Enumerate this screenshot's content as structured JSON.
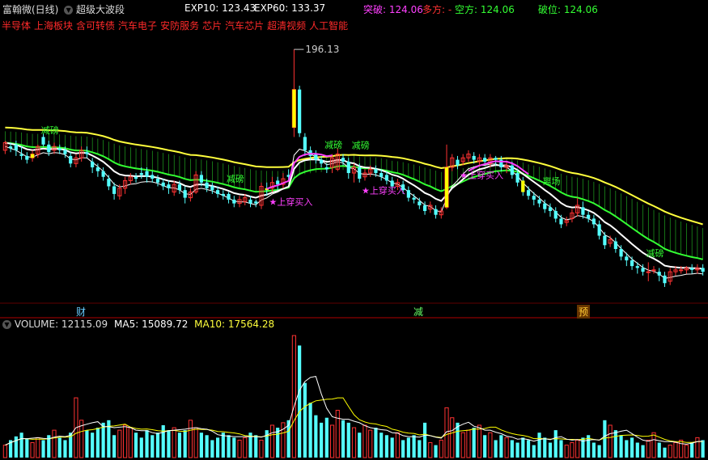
{
  "header": {
    "stock_name": "富翰微(日线)",
    "formula_name": "超级大波段",
    "exp10_label": "EXP10: 123.43",
    "exp60_label": "EXP60: 133.37",
    "tupo_label": "突破: 124.06",
    "duofang_label": "多方: -",
    "kongfang_label": "空方: 124.06",
    "powei_label": "破位: 124.06"
  },
  "sectors": [
    "半导体",
    "上海板块",
    "含可转债",
    "汽车电子",
    "安防服务",
    "芯片",
    "汽车芯片",
    "超清视频",
    "人工智能"
  ],
  "annotations": {
    "high_price": "196.13",
    "signal_reduce": "减磅",
    "signal_buy": "上穿买入",
    "signal_exit": "离场"
  },
  "bottom_markers": [
    "财",
    "减",
    "预"
  ],
  "volume_header": {
    "volume_label": "VOLUME: 12115.09",
    "ma5_label": "MA5: 15089.72",
    "ma10_label": "MA10: 17564.28"
  },
  "colors": {
    "up": "#ff3232",
    "down": "#54ffff",
    "exp10": "#ffffff",
    "exp60_yellow": "#ffff3c",
    "band_green": "#33ff33",
    "magenta": "#ff40ff",
    "vol_ma5": "#ffffff",
    "vol_ma10": "#ffff00"
  },
  "chart_data": {
    "type": "candlestick",
    "candles": [
      [
        143,
        147,
        148,
        141
      ],
      [
        145,
        144,
        147,
        142
      ],
      [
        146,
        143,
        148,
        140
      ],
      [
        141,
        140,
        145,
        138
      ],
      [
        140,
        138,
        142,
        136
      ],
      [
        139,
        141,
        143,
        137
      ],
      [
        141,
        145,
        146,
        139
      ],
      [
        150,
        146,
        152,
        145
      ],
      [
        146,
        142,
        148,
        140
      ],
      [
        143,
        145,
        147,
        141
      ],
      [
        144,
        143,
        146,
        141
      ],
      [
        143,
        141,
        145,
        139
      ],
      [
        140,
        136,
        142,
        134
      ],
      [
        136,
        139,
        141,
        134
      ],
      [
        139,
        143,
        145,
        137
      ],
      [
        142,
        141,
        145,
        139
      ],
      [
        137,
        134,
        139,
        131
      ],
      [
        134,
        132,
        136,
        129
      ],
      [
        132,
        129,
        134,
        127
      ],
      [
        128,
        124,
        130,
        122
      ],
      [
        124,
        120,
        126,
        117
      ],
      [
        119,
        123,
        125,
        117
      ],
      [
        123,
        127,
        129,
        120
      ],
      [
        127,
        129,
        131,
        125
      ],
      [
        129,
        128,
        131,
        126
      ],
      [
        131,
        130,
        134,
        128
      ],
      [
        132,
        129,
        134,
        126
      ],
      [
        130,
        128,
        132,
        126
      ],
      [
        128,
        126,
        130,
        124
      ],
      [
        126,
        124,
        128,
        122
      ],
      [
        125,
        123,
        127,
        120
      ],
      [
        121,
        125,
        127,
        119
      ],
      [
        125,
        122,
        127,
        120
      ],
      [
        122,
        118,
        124,
        115
      ],
      [
        118,
        121,
        123,
        116
      ],
      [
        121,
        130,
        132,
        120
      ],
      [
        130,
        126,
        132,
        124
      ],
      [
        126,
        123,
        128,
        121
      ],
      [
        124,
        122,
        126,
        120
      ],
      [
        122,
        120,
        124,
        118
      ],
      [
        120,
        119,
        122,
        117
      ],
      [
        120,
        117,
        121,
        115
      ],
      [
        117,
        115,
        119,
        113
      ],
      [
        115,
        117,
        119,
        113
      ],
      [
        116,
        118,
        120,
        114
      ],
      [
        117,
        115,
        119,
        113
      ],
      [
        116,
        115,
        117,
        113
      ],
      [
        114,
        124,
        126,
        112
      ],
      [
        123,
        122,
        126,
        119
      ],
      [
        123,
        126,
        129,
        121
      ],
      [
        127,
        125,
        129,
        122
      ],
      [
        125,
        128,
        131,
        123
      ],
      [
        130,
        129,
        133,
        127
      ],
      [
        155,
        175,
        196.13,
        150
      ],
      [
        175,
        152,
        177,
        150
      ],
      [
        150,
        143,
        152,
        140
      ],
      [
        143,
        140,
        145,
        138
      ],
      [
        141,
        138,
        143,
        136
      ],
      [
        138,
        136,
        140,
        134
      ],
      [
        134,
        133,
        136,
        131
      ],
      [
        134,
        139,
        141,
        131
      ],
      [
        133,
        141,
        144,
        132
      ],
      [
        139,
        137,
        141,
        135
      ],
      [
        137,
        131,
        139,
        128
      ],
      [
        131,
        134,
        136,
        126
      ],
      [
        134,
        128,
        136,
        126
      ],
      [
        129,
        131,
        133,
        127
      ],
      [
        131,
        133,
        135,
        129
      ],
      [
        133,
        131,
        135,
        129
      ],
      [
        131,
        129,
        133,
        127
      ],
      [
        130,
        127,
        132,
        125
      ],
      [
        127,
        124,
        129,
        122
      ],
      [
        124,
        126,
        128,
        122
      ],
      [
        125,
        122,
        127,
        120
      ],
      [
        122,
        118,
        124,
        116
      ],
      [
        118,
        117,
        120,
        115
      ],
      [
        116,
        114,
        118,
        112
      ],
      [
        114,
        111,
        116,
        109
      ],
      [
        112,
        114,
        116,
        110
      ],
      [
        112,
        109,
        114,
        107
      ],
      [
        109,
        111,
        113,
        107
      ],
      [
        113,
        134,
        146,
        112
      ],
      [
        134,
        139,
        141,
        132
      ],
      [
        138,
        135,
        140,
        133
      ],
      [
        137,
        139,
        141,
        135
      ],
      [
        139,
        141,
        143,
        137
      ],
      [
        140,
        138,
        142,
        136
      ],
      [
        137,
        139,
        141,
        135
      ],
      [
        139,
        137,
        141,
        135
      ],
      [
        136,
        139,
        141,
        134
      ],
      [
        139,
        138,
        140,
        135
      ],
      [
        138,
        134,
        140,
        132
      ],
      [
        134,
        135,
        137,
        131
      ],
      [
        135,
        130,
        137,
        128
      ],
      [
        131,
        126,
        133,
        124
      ],
      [
        127,
        121,
        129,
        119
      ],
      [
        122,
        119,
        124,
        117
      ],
      [
        119,
        117,
        121,
        114
      ],
      [
        117,
        115,
        119,
        113
      ],
      [
        115,
        112,
        117,
        110
      ],
      [
        113,
        111,
        115,
        108
      ],
      [
        111,
        107,
        113,
        105
      ],
      [
        107,
        104,
        109,
        102
      ],
      [
        105,
        106,
        108,
        103
      ],
      [
        107,
        110,
        112,
        105
      ],
      [
        110,
        114,
        118,
        108
      ],
      [
        113,
        109,
        116,
        107
      ],
      [
        109,
        107,
        111,
        105
      ],
      [
        107,
        104,
        109,
        102
      ],
      [
        104,
        98,
        106,
        96
      ],
      [
        98,
        93,
        100,
        91
      ],
      [
        94,
        96,
        98,
        92
      ],
      [
        95,
        91,
        97,
        89
      ],
      [
        91,
        87,
        93,
        85
      ],
      [
        87,
        85,
        89,
        82
      ],
      [
        85,
        82,
        87,
        80
      ],
      [
        82,
        81,
        84,
        78
      ],
      [
        81,
        79,
        83,
        77
      ],
      [
        79,
        79,
        84,
        74
      ],
      [
        80,
        80,
        82,
        78
      ],
      [
        79,
        77,
        81,
        74
      ],
      [
        77,
        73,
        79,
        71
      ],
      [
        74,
        79,
        81,
        72
      ],
      [
        79,
        80,
        82,
        77
      ],
      [
        80,
        80,
        82,
        78
      ],
      [
        80,
        81,
        82,
        78
      ],
      [
        81,
        80,
        83,
        78
      ],
      [
        80,
        81,
        83,
        78
      ],
      [
        81,
        79,
        83,
        77
      ]
    ],
    "volume": [
      10,
      14,
      17,
      20,
      15,
      12,
      16,
      14,
      18,
      22,
      16,
      14,
      20,
      48,
      30,
      22,
      20,
      24,
      28,
      30,
      18,
      22,
      26,
      24,
      20,
      16,
      22,
      18,
      20,
      26,
      22,
      24,
      20,
      22,
      30,
      24,
      20,
      18,
      14,
      16,
      20,
      18,
      16,
      14,
      16,
      20,
      18,
      14,
      22,
      26,
      24,
      28,
      30,
      98,
      90,
      60,
      44,
      34,
      28,
      32,
      26,
      38,
      30,
      28,
      24,
      20,
      26,
      22,
      24,
      20,
      18,
      16,
      20,
      14,
      16,
      18,
      14,
      28,
      12,
      10,
      14,
      40,
      32,
      28,
      20,
      22,
      24,
      26,
      18,
      20,
      14,
      18,
      16,
      14,
      12,
      16,
      14,
      10,
      20,
      16,
      12,
      22,
      14,
      10,
      12,
      14,
      16,
      18,
      12,
      10,
      30,
      26,
      22,
      18,
      14,
      16,
      12,
      10,
      14,
      20,
      12,
      8,
      10,
      12,
      14,
      10,
      12,
      16,
      14,
      12,
      10,
      8
    ]
  }
}
